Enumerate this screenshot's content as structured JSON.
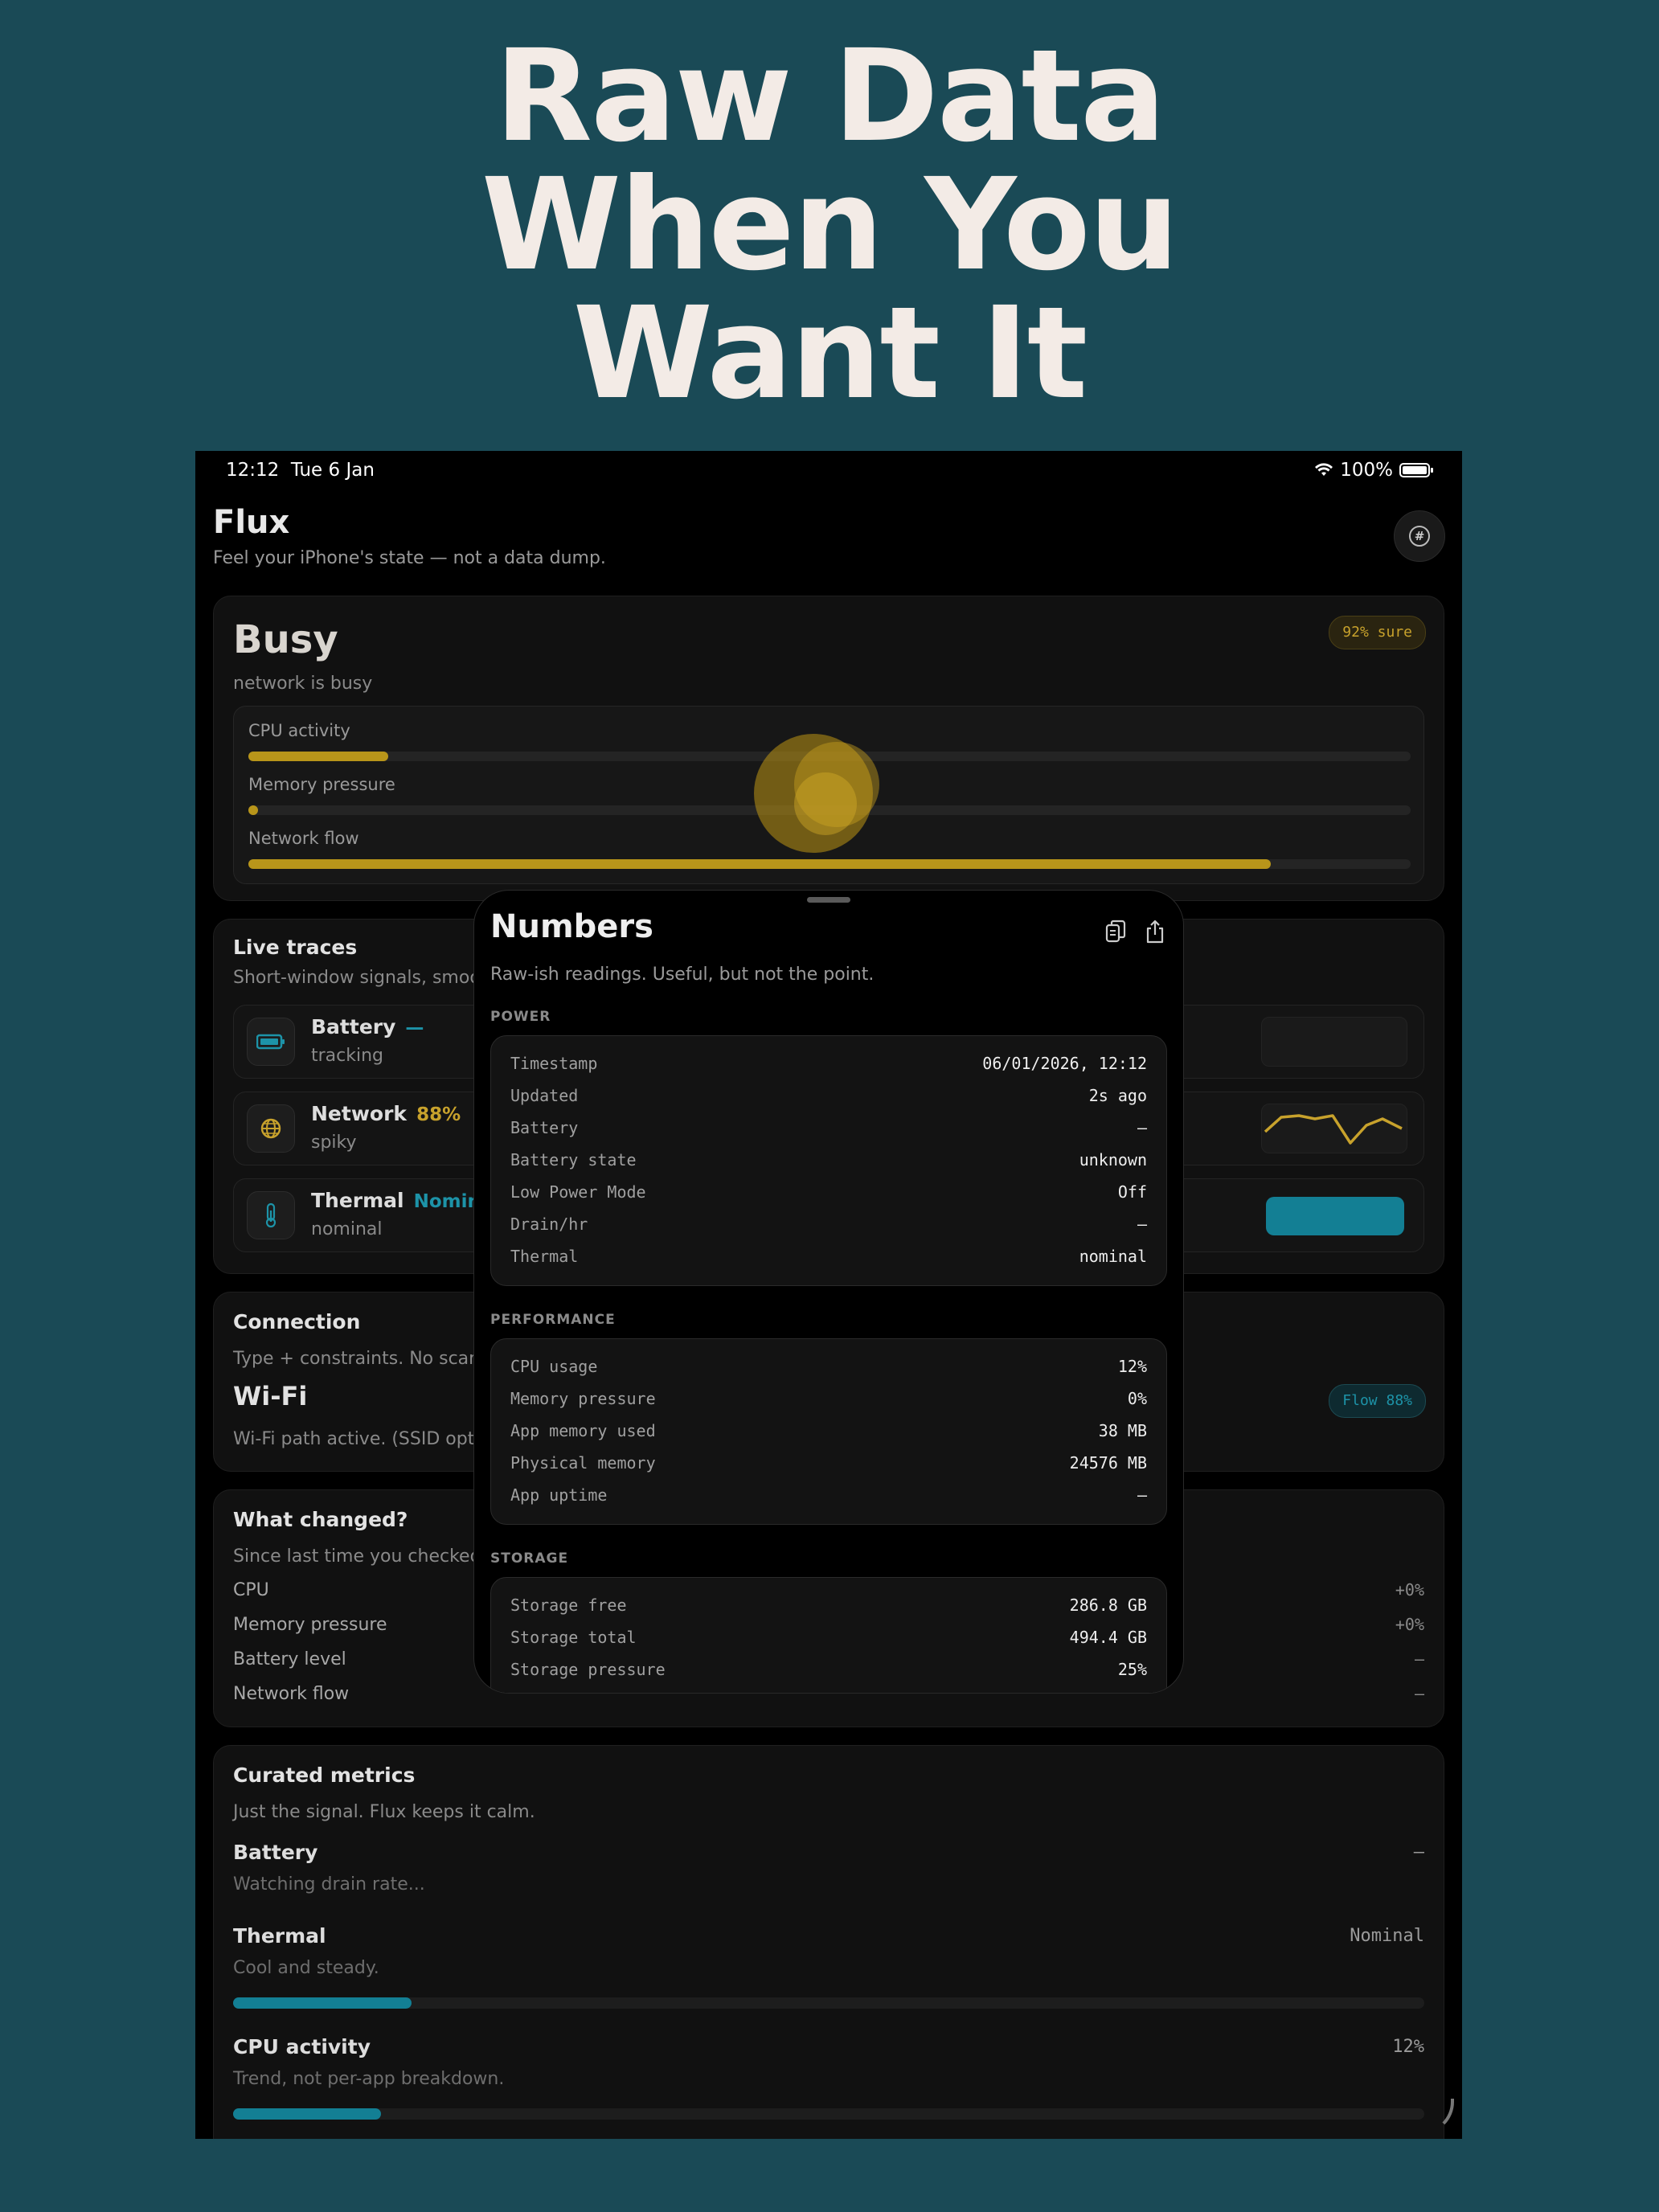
{
  "headline": [
    "Raw Data",
    "When You",
    "Want It"
  ],
  "status_bar": {
    "time": "12:12",
    "date": "Tue 6 Jan",
    "battery": "100%"
  },
  "app": {
    "title": "Flux",
    "subtitle": "Feel your iPhone's state — not a data dump."
  },
  "state_card": {
    "title": "Busy",
    "subtitle": "network is busy",
    "confidence": "92% sure",
    "bars": [
      {
        "label": "CPU activity",
        "fraction": 0.12
      },
      {
        "label": "Memory pressure",
        "fraction": 0.0
      },
      {
        "label": "Network flow",
        "fraction": 0.88
      }
    ]
  },
  "live_traces": {
    "title": "Live traces",
    "subtitle": "Short-window signals, smoothed",
    "rows": [
      {
        "name": "Battery",
        "value": "—",
        "state": "tracking",
        "icon": "battery-icon",
        "value_color": "#1d93a8"
      },
      {
        "name": "Network",
        "value": "88%",
        "state": "spiky",
        "icon": "globe-icon",
        "value_color": "#c8a22c"
      },
      {
        "name": "Thermal",
        "value": "Nominal",
        "state": "nominal",
        "icon": "thermometer-icon",
        "value_color": "#1d93a8"
      }
    ]
  },
  "connection": {
    "title": "Connection",
    "subtitle": "Type + constraints. No scanning.",
    "type": "Wi-Fi",
    "detail": "Wi-Fi path active. (SSID optional)",
    "flow": "Flow 88%"
  },
  "what_changed": {
    "title": "What changed?",
    "subtitle": "Since last time you checked.",
    "rows": [
      {
        "label": "CPU",
        "value": "+0%"
      },
      {
        "label": "Memory pressure",
        "value": "+0%"
      },
      {
        "label": "Battery level",
        "value": "—"
      },
      {
        "label": "Network flow",
        "value": "—"
      }
    ]
  },
  "curated": {
    "title": "Curated metrics",
    "subtitle": "Just the signal. Flux keeps it calm.",
    "items": [
      {
        "name": "Battery",
        "desc": "Watching drain rate...",
        "value": "—"
      },
      {
        "name": "Thermal",
        "desc": "Cool and steady.",
        "value": "Nominal",
        "fraction": 0.15
      },
      {
        "name": "CPU activity",
        "desc": "Trend, not per-app breakdown.",
        "value": "12%",
        "fraction": 0.124
      }
    ]
  },
  "numbers_sheet": {
    "title": "Numbers",
    "subtitle": "Raw-ish readings. Useful, but not the point.",
    "sections": [
      {
        "label": "POWER",
        "rows": [
          {
            "k": "Timestamp",
            "v": "06/01/2026, 12:12"
          },
          {
            "k": "Updated",
            "v": "2s ago"
          },
          {
            "k": "Battery",
            "v": "—"
          },
          {
            "k": "Battery state",
            "v": "unknown"
          },
          {
            "k": "Low Power Mode",
            "v": "Off"
          },
          {
            "k": "Drain/hr",
            "v": "—"
          },
          {
            "k": "Thermal",
            "v": "nominal"
          }
        ]
      },
      {
        "label": "PERFORMANCE",
        "rows": [
          {
            "k": "CPU usage",
            "v": "12%"
          },
          {
            "k": "Memory pressure",
            "v": "0%"
          },
          {
            "k": "App memory used",
            "v": "38 MB"
          },
          {
            "k": "Physical memory",
            "v": "24576 MB"
          },
          {
            "k": "App uptime",
            "v": "—"
          }
        ]
      },
      {
        "label": "STORAGE",
        "rows": [
          {
            "k": "Storage free",
            "v": "286.8 GB"
          },
          {
            "k": "Storage total",
            "v": "494.4 GB"
          },
          {
            "k": "Storage pressure",
            "v": "25%"
          }
        ]
      }
    ]
  },
  "colors": {
    "accent_gold": "#b8951a",
    "accent_teal": "#137f94",
    "background": "#1a4a56"
  }
}
